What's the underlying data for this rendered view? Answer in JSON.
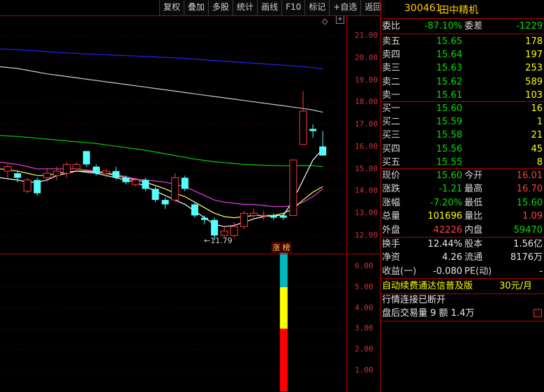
{
  "toolbar": [
    "复权",
    "叠加",
    "多股",
    "统计",
    "画线",
    "F10",
    "标记",
    "+自选",
    "返回"
  ],
  "chart": {
    "price_axis": [
      "21.00",
      "20.00",
      "19.00",
      "18.00",
      "17.00",
      "16.00",
      "15.00",
      "14.00",
      "13.00",
      "12.00"
    ],
    "low_label": "←11.79",
    "limit_tag": "涨 榜",
    "indicator_axis": [
      "6.00",
      "5.00",
      "4.00",
      "3.00",
      "2.00",
      "1.00"
    ],
    "indicator_bar": {
      "red": 2,
      "yellow": 2,
      "cyan": 2
    },
    "diamond": "◇",
    "plus": "+"
  },
  "chart_data": {
    "type": "candlestick",
    "ylim": [
      11.5,
      21.5
    ],
    "candles": [
      {
        "o": 14.9,
        "c": 15.1,
        "h": 15.2,
        "l": 14.5
      },
      {
        "o": 14.8,
        "c": 14.6,
        "h": 14.9,
        "l": 14.4
      },
      {
        "o": 14.0,
        "c": 14.5,
        "h": 14.6,
        "l": 13.9
      },
      {
        "o": 14.5,
        "c": 13.9,
        "h": 14.6,
        "l": 13.8
      },
      {
        "o": 14.6,
        "c": 14.8,
        "h": 15.0,
        "l": 14.4
      },
      {
        "o": 14.7,
        "c": 14.9,
        "h": 15.1,
        "l": 14.5
      },
      {
        "o": 14.8,
        "c": 15.2,
        "h": 15.3,
        "l": 14.6
      },
      {
        "o": 15.0,
        "c": 15.2,
        "h": 15.3,
        "l": 14.9
      },
      {
        "o": 15.8,
        "c": 15.2,
        "h": 15.8,
        "l": 15.1
      },
      {
        "o": 15.1,
        "c": 14.8,
        "h": 15.2,
        "l": 14.7
      },
      {
        "o": 14.8,
        "c": 14.9,
        "h": 15.0,
        "l": 14.6
      },
      {
        "o": 14.9,
        "c": 14.6,
        "h": 15.1,
        "l": 14.5
      },
      {
        "o": 14.6,
        "c": 14.4,
        "h": 14.7,
        "l": 14.3
      },
      {
        "o": 14.3,
        "c": 14.5,
        "h": 14.6,
        "l": 14.2
      },
      {
        "o": 14.5,
        "c": 14.1,
        "h": 14.6,
        "l": 14.0
      },
      {
        "o": 14.1,
        "c": 13.6,
        "h": 14.2,
        "l": 13.5
      },
      {
        "o": 13.6,
        "c": 13.4,
        "h": 13.7,
        "l": 13.2
      },
      {
        "o": 13.6,
        "c": 14.6,
        "h": 14.8,
        "l": 13.5
      },
      {
        "o": 14.6,
        "c": 14.1,
        "h": 14.7,
        "l": 14.0
      },
      {
        "o": 13.4,
        "c": 12.9,
        "h": 13.5,
        "l": 12.8
      },
      {
        "o": 12.8,
        "c": 12.7,
        "h": 12.9,
        "l": 12.5
      },
      {
        "o": 12.7,
        "c": 12.0,
        "h": 12.8,
        "l": 11.79
      },
      {
        "o": 12.0,
        "c": 12.2,
        "h": 12.4,
        "l": 11.9
      },
      {
        "o": 12.0,
        "c": 12.4,
        "h": 12.6,
        "l": 11.9
      },
      {
        "o": 12.4,
        "c": 13.0,
        "h": 13.1,
        "l": 12.3
      },
      {
        "o": 12.9,
        "c": 13.0,
        "h": 13.2,
        "l": 12.8
      },
      {
        "o": 12.9,
        "c": 12.9,
        "h": 13.1,
        "l": 12.7
      },
      {
        "o": 12.9,
        "c": 12.8,
        "h": 13.0,
        "l": 12.7
      },
      {
        "o": 12.9,
        "c": 12.8,
        "h": 13.0,
        "l": 12.7
      },
      {
        "o": 12.9,
        "c": 15.4,
        "h": 15.4,
        "l": 12.9
      },
      {
        "o": 16.1,
        "c": 17.6,
        "h": 18.5,
        "l": 16.1
      },
      {
        "o": 16.8,
        "c": 16.7,
        "h": 17.0,
        "l": 16.4
      },
      {
        "o": 16.01,
        "c": 15.6,
        "h": 16.7,
        "l": 15.6
      }
    ],
    "ma_lines": [
      {
        "color": "#2222ff",
        "values": [
          20.4,
          20.37,
          20.34,
          20.31,
          20.28,
          20.25,
          20.22,
          20.2,
          20.18,
          20.16,
          20.14,
          20.12,
          20.1,
          20.08,
          20.06,
          20.04,
          20.02,
          20.0,
          19.97,
          19.94,
          19.91,
          19.88,
          19.85,
          19.82,
          19.79,
          19.76,
          19.73,
          19.7,
          19.67,
          19.64,
          19.6,
          19.56,
          19.5
        ]
      },
      {
        "color": "#cccccc",
        "values": [
          19.6,
          19.52,
          19.44,
          19.36,
          19.28,
          19.22,
          19.16,
          19.1,
          19.04,
          18.98,
          18.92,
          18.86,
          18.8,
          18.74,
          18.68,
          18.62,
          18.56,
          18.5,
          18.44,
          18.38,
          18.32,
          18.26,
          18.2,
          18.14,
          18.08,
          18.02,
          17.96,
          17.9,
          17.84,
          17.78,
          17.72,
          17.65,
          17.55
        ]
      },
      {
        "color": "#00d000",
        "values": [
          16.5,
          16.46,
          16.42,
          16.38,
          16.34,
          16.3,
          16.26,
          16.22,
          16.18,
          16.14,
          16.08,
          16.02,
          15.96,
          15.9,
          15.84,
          15.76,
          15.68,
          15.6,
          15.52,
          15.44,
          15.38,
          15.32,
          15.28,
          15.24,
          15.2,
          15.18,
          15.16,
          15.15,
          15.14,
          15.14,
          15.15,
          15.14,
          15.1
        ]
      },
      {
        "color": "#e040e0",
        "values": [
          15.3,
          15.2,
          15.1,
          15.0,
          15.0,
          15.0,
          15.0,
          15.0,
          14.95,
          14.9,
          14.85,
          14.75,
          14.65,
          14.55,
          14.5,
          14.45,
          14.4,
          14.3,
          14.2,
          14.0,
          13.8,
          13.6,
          13.5,
          13.45,
          13.4,
          13.4,
          13.35,
          13.3,
          13.3,
          13.35,
          13.5,
          13.75,
          14.1
        ]
      },
      {
        "color": "#ffff66",
        "values": [
          15.0,
          14.9,
          14.8,
          14.7,
          14.7,
          14.8,
          14.85,
          14.9,
          14.9,
          14.85,
          14.8,
          14.7,
          14.6,
          14.5,
          14.4,
          14.25,
          14.1,
          13.9,
          13.75,
          13.5,
          13.25,
          13.0,
          12.85,
          12.8,
          12.85,
          12.9,
          12.9,
          12.9,
          13.0,
          13.2,
          13.6,
          13.95,
          14.2
        ]
      },
      {
        "color": "#ffffff",
        "values": [
          14.6,
          14.5,
          14.4,
          14.4,
          14.5,
          14.7,
          14.8,
          14.9,
          14.85,
          14.8,
          14.7,
          14.6,
          14.5,
          14.4,
          14.2,
          14.0,
          13.8,
          13.6,
          13.4,
          13.1,
          12.8,
          12.5,
          12.4,
          12.45,
          12.6,
          12.75,
          12.85,
          12.9,
          12.9,
          13.6,
          14.5,
          15.4,
          15.9
        ]
      }
    ]
  },
  "panel": {
    "code": "300461",
    "name": "田中精机",
    "weibi_label": "委比",
    "weibi_value": "-87.10%",
    "weicha_label": "委差",
    "weicha_value": "-1229",
    "asks": [
      {
        "label": "卖五",
        "price": "15.65",
        "vol": "178"
      },
      {
        "label": "卖四",
        "price": "15.64",
        "vol": "197"
      },
      {
        "label": "卖三",
        "price": "15.63",
        "vol": "253"
      },
      {
        "label": "卖二",
        "price": "15.62",
        "vol": "589"
      },
      {
        "label": "卖一",
        "price": "15.61",
        "vol": "103"
      }
    ],
    "bids": [
      {
        "label": "买一",
        "price": "15.60",
        "vol": "16"
      },
      {
        "label": "买二",
        "price": "15.59",
        "vol": "1"
      },
      {
        "label": "买三",
        "price": "15.58",
        "vol": "21"
      },
      {
        "label": "买四",
        "price": "15.56",
        "vol": "45"
      },
      {
        "label": "买五",
        "price": "15.55",
        "vol": "8"
      }
    ],
    "quote": [
      {
        "l1": "现价",
        "v1": "15.60",
        "l2": "今开",
        "v2": "16.01"
      },
      {
        "l1": "涨跌",
        "v1": "-1.21",
        "l2": "最高",
        "v2": "16.70"
      },
      {
        "l1": "涨幅",
        "v1": "-7.20%",
        "l2": "最低",
        "v2": "15.60"
      },
      {
        "l1": "总量",
        "v1": "101696",
        "l2": "量比",
        "v2": "1.09"
      },
      {
        "l1": "外盘",
        "v1": "42226",
        "l2": "内盘",
        "v2": "59470"
      }
    ],
    "fund": [
      {
        "l1": "换手",
        "v1": "12.44%",
        "l2": "股本",
        "v2": "1.56亿"
      },
      {
        "l1": "净资",
        "v1": "4.26",
        "l2": "流通",
        "v2": "8176万"
      },
      {
        "l1": "收益(一)",
        "v1": "-0.080",
        "l2": "PE(动)",
        "v2": "-"
      }
    ],
    "ad_text": "自动续费通达信普及版",
    "ad_price": "30元/月",
    "status": "行情连接已断开",
    "after_hours": "盘后交易量 9 额 1.4万"
  }
}
